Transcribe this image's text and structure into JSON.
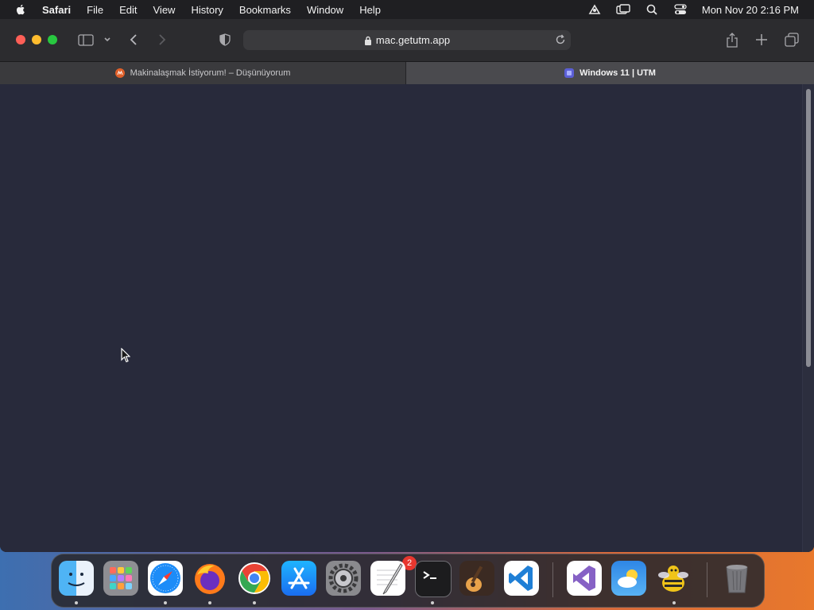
{
  "menubar": {
    "app_name": "Safari",
    "items": [
      "File",
      "Edit",
      "View",
      "History",
      "Bookmarks",
      "Window",
      "Help"
    ],
    "clock": "Mon Nov 20  2:16 PM"
  },
  "toolbar": {
    "url": "mac.getutm.app"
  },
  "tabs": [
    {
      "label": "Makinalaşmak İstiyorum! – Düşünüyorum",
      "active": false
    },
    {
      "label": "Windows 11 | UTM",
      "active": true
    }
  ],
  "dock": {
    "apps": [
      "Finder",
      "Launchpad",
      "Safari",
      "Firefox",
      "Chrome",
      "App Store",
      "System Settings",
      "TextEdit",
      "Terminal",
      "GarageBand",
      "Visual Studio Code",
      "Visual Studio",
      "Weather",
      "Cyberduck",
      "Trash"
    ],
    "settings_badge": "2"
  },
  "colors": {
    "page_background": "#282a3b",
    "accent": "#0a84ff"
  }
}
